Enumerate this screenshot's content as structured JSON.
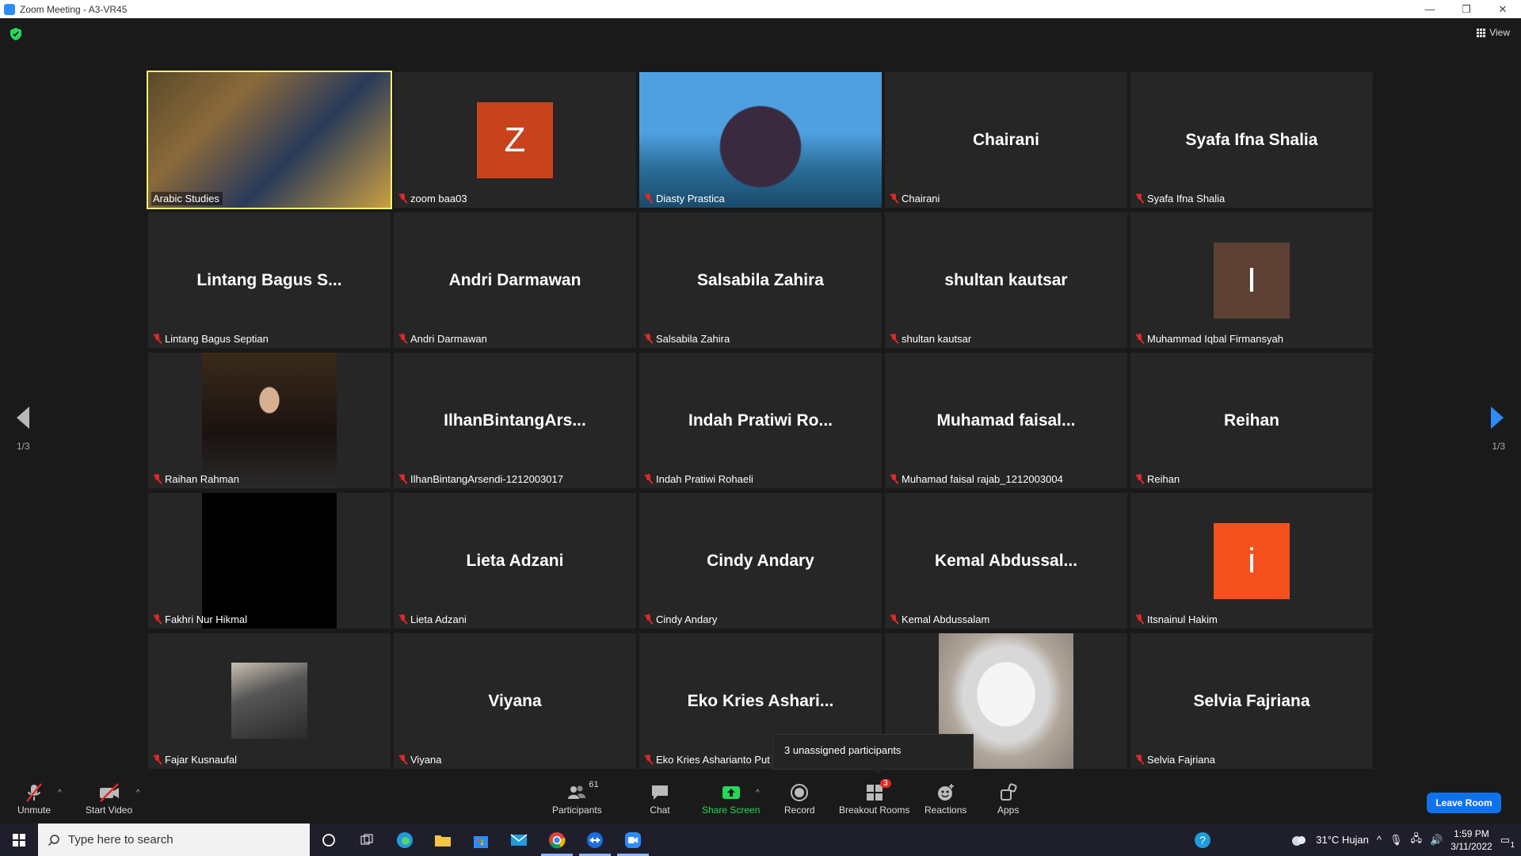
{
  "window": {
    "title": "Zoom Meeting - A3-VR45"
  },
  "top": {
    "view_label": "View"
  },
  "pager": {
    "left": "1/3",
    "right": "1/3"
  },
  "tiles": [
    {
      "name": "Arabic Studies",
      "type": "video",
      "active": true,
      "muted": false
    },
    {
      "name": "zoom baa03",
      "type": "avatar",
      "avatar_letter": "Z",
      "avatar_color": "#c8431c",
      "muted": true
    },
    {
      "name": "Diasty Prastica",
      "type": "video",
      "muted": true
    },
    {
      "name": "Chairani",
      "type": "text",
      "display": "Chairani",
      "muted": true
    },
    {
      "name": "Syafa Ifna Shalia",
      "type": "text",
      "display": "Syafa Ifna Shalia",
      "muted": true
    },
    {
      "name": "Lintang Bagus Septian",
      "type": "text",
      "display": "Lintang Bagus S...",
      "muted": true
    },
    {
      "name": "Andri Darmawan",
      "type": "text",
      "display": "Andri Darmawan",
      "muted": true
    },
    {
      "name": "Salsabila Zahira",
      "type": "text",
      "display": "Salsabila Zahira",
      "muted": true
    },
    {
      "name": "shultan kautsar",
      "type": "text",
      "display": "shultan kautsar",
      "muted": true
    },
    {
      "name": "Muhammad Iqbal Firmansyah",
      "type": "avatar",
      "avatar_letter": "I",
      "avatar_color": "#5c4033",
      "muted": true
    },
    {
      "name": "Raihan Rahman",
      "type": "video",
      "muted": true
    },
    {
      "name": "IlhanBintangArsendi-1212003017",
      "type": "text",
      "display": "IlhanBintangArs...",
      "muted": true
    },
    {
      "name": "Indah Pratiwi Rohaeli",
      "type": "text",
      "display": "Indah Pratiwi Ro...",
      "muted": true
    },
    {
      "name": "Muhamad faisal rajab_1212003004",
      "type": "text",
      "display": "Muhamad faisal...",
      "muted": true
    },
    {
      "name": "Reihan",
      "type": "text",
      "display": "Reihan",
      "muted": true
    },
    {
      "name": "Fakhri Nur Hikmal",
      "type": "video",
      "muted": true
    },
    {
      "name": "Lieta Adzani",
      "type": "text",
      "display": "Lieta Adzani",
      "muted": true
    },
    {
      "name": "Cindy Andary",
      "type": "text",
      "display": "Cindy Andary",
      "muted": true
    },
    {
      "name": "Kemal Abdussalam",
      "type": "text",
      "display": "Kemal Abdussal...",
      "muted": true
    },
    {
      "name": "Itsnainul Hakim",
      "type": "avatar",
      "avatar_letter": "i",
      "avatar_color": "#f4511e",
      "muted": true
    },
    {
      "name": "Fajar Kusnaufal",
      "type": "video",
      "muted": true
    },
    {
      "name": "Viyana",
      "type": "text",
      "display": "Viyana",
      "muted": true
    },
    {
      "name": "Eko Kries Ashari",
      "type": "text",
      "display": "Eko Kries Ashari...",
      "muted": true
    },
    {
      "name": "",
      "type": "video",
      "muted": false
    },
    {
      "name": "Selvia Fajriana",
      "type": "text",
      "display": "Selvia Fajriana",
      "muted": true
    }
  ],
  "tiles_visible_names": {
    "eko_partial": "Eko Kries Asharianto Put"
  },
  "tooltip": {
    "text": "3 unassigned participants"
  },
  "toolbar": {
    "unmute": "Unmute",
    "start_video": "Start Video",
    "participants": "Participants",
    "participants_count": "61",
    "chat": "Chat",
    "share_screen": "Share Screen",
    "record": "Record",
    "breakout_rooms": "Breakout Rooms",
    "breakout_badge": "3",
    "reactions": "Reactions",
    "apps": "Apps",
    "leave": "Leave Room"
  },
  "taskbar": {
    "search_placeholder": "Type here to search",
    "weather": "31°C Hujan",
    "time": "1:59 PM",
    "date": "3/11/2022",
    "notif_count": "1"
  },
  "colors": {
    "accent": "#2d8cff",
    "share_green": "#23d959",
    "leave_blue": "#0e72ed",
    "active_speaker": "#f4f277",
    "muted_red": "#e02828"
  }
}
